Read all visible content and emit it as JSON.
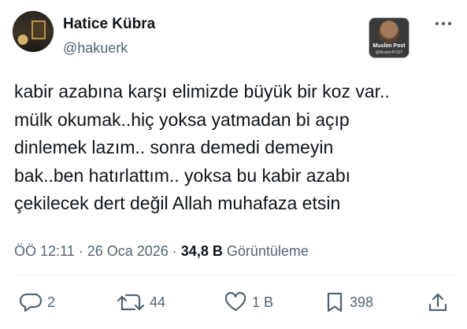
{
  "author": {
    "name": "Hatice Kübra",
    "handle": "@hakuerk"
  },
  "media_badge": {
    "label": "Muslim Post",
    "sub_label": "@MuslimPOST"
  },
  "tweet": {
    "lines": [
      "kabir azabına karşı elimizde büyük bir koz var..",
      "mülk okumak..hiç yoksa yatmadan bi açıp",
      "dinlemek lazım.. sonra demedi demeyin",
      "bak..ben hatırlattım.. yoksa bu kabir azabı",
      "çekilecek dert değil Allah muhafaza etsin"
    ]
  },
  "meta": {
    "time": "ÖÖ 12:11",
    "separator": " · ",
    "date": "26 Oca 2026",
    "views_count": "34,8 B",
    "views_label": "Görüntüleme"
  },
  "actions": {
    "reply_count": "2",
    "retweet_count": "44",
    "like_count": "1 B",
    "bookmark_count": "398"
  },
  "icons": {
    "more": "more-horizontal-icon",
    "reply": "reply-icon",
    "retweet": "retweet-icon",
    "like": "heart-icon",
    "bookmark": "bookmark-icon",
    "share": "share-icon"
  },
  "colors": {
    "text": "#0f1419",
    "secondary": "#536471",
    "divider": "#eff3f4"
  }
}
